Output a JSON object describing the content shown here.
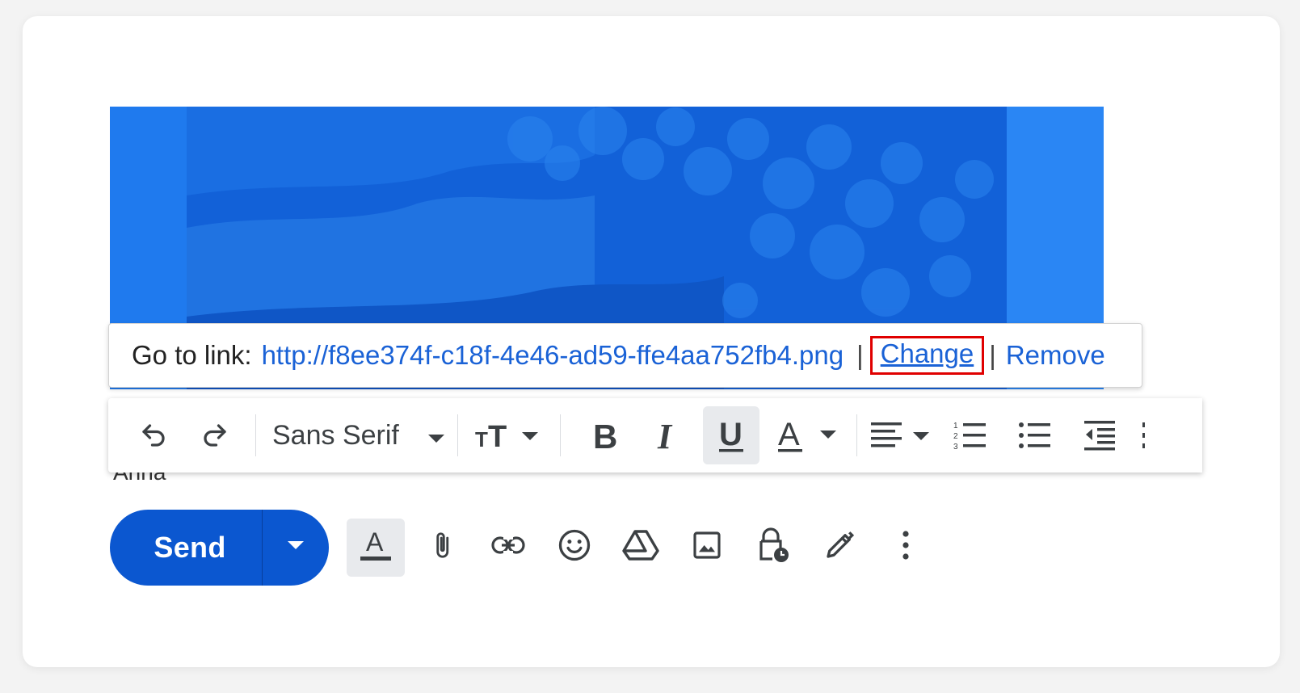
{
  "link_bubble": {
    "prefix": "Go to link:",
    "url": "http://f8ee374f-c18f-4e46-ad59-ffe4aa752fb4.png",
    "separator": "|",
    "change_label": "Change",
    "remove_label": "Remove"
  },
  "body_fragment_text": "Anna",
  "format_toolbar": {
    "font_name": "Sans Serif",
    "buttons": [
      "undo-icon",
      "redo-icon",
      "font-select",
      "text-size-icon",
      "bold-icon",
      "italic-icon",
      "underline-icon",
      "text-color-icon",
      "align-icon",
      "numbered-list-icon",
      "bulleted-list-icon",
      "indent-less-icon"
    ],
    "active": "underline-icon"
  },
  "compose_actions": {
    "send_label": "Send",
    "icons": [
      "formatting-options-icon",
      "attach-file-icon",
      "insert-link-icon",
      "emoji-icon",
      "google-drive-icon",
      "insert-photo-icon",
      "confidential-mode-icon",
      "signature-icon",
      "more-options-icon"
    ]
  },
  "colors": {
    "send_button": "#0b57d0",
    "link": "#1a62d6",
    "highlight_box": "#e00000",
    "image_tint": "#1f75ea",
    "active_button_bg": "#e8eaed"
  }
}
